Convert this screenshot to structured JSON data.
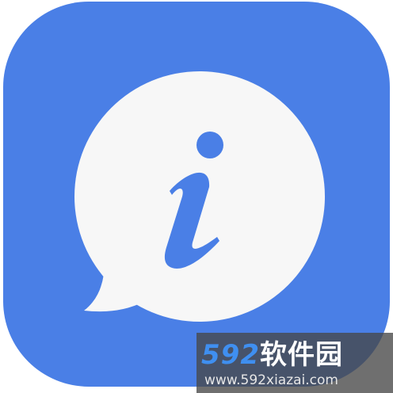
{
  "app_icon": {
    "name": "info-chat-icon",
    "colors": {
      "tile": "#4a7fe6",
      "bubble": "#f7f7f7",
      "glyph": "#4a7fe6"
    }
  },
  "watermark": {
    "brand_digits": "592",
    "brand_text": "软件园",
    "url": "www.592xiazai.com"
  }
}
